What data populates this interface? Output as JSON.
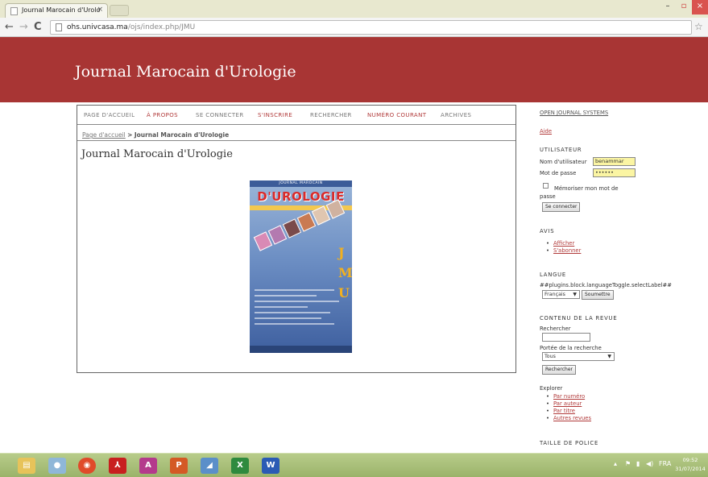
{
  "browser": {
    "tab_title": "Journal Marocain d'Urolo",
    "tab_close": "×",
    "url_host": "ohs.univcasa.ma",
    "url_path": "/ojs/index.php/JMU"
  },
  "header": {
    "journal_title": "Journal Marocain d'Urologie"
  },
  "nav": {
    "items": [
      "PAGE D'ACCUEIL",
      "À PROPOS",
      "SE CONNECTER",
      "S'INSCRIRE",
      "RECHERCHER",
      "NUMÉRO COURANT",
      "ARCHIVES"
    ]
  },
  "breadcrumb": {
    "home": "Page d'accueil",
    "separator": ">",
    "current": "Journal Marocain d'Urologie"
  },
  "main": {
    "title": "Journal Marocain d'Urologie"
  },
  "cover": {
    "small_title": "JOURNAL MAROCAIN",
    "big_title": "D'UROLOGIE",
    "letters": [
      "J",
      "M",
      "U"
    ]
  },
  "sidebar": {
    "ojs_link": "OPEN JOURNAL SYSTEMS",
    "help_link": "Aide",
    "user_heading": "UTILISATEUR",
    "username_label": "Nom d'utilisateur",
    "username_value": "benammar",
    "password_label": "Mot de passe",
    "password_value": "••••••",
    "remember_label_1": "Mémoriser mon mot de",
    "remember_label_2": "passe",
    "login_button": "Se connecter",
    "notices_heading": "AVIS",
    "notices_links": [
      "Afficher",
      "S'abonner"
    ],
    "language_heading": "LANGUE",
    "language_label": "##plugins.block.languageToggle.selectLabel##",
    "language_value": "Français",
    "language_submit": "Soumettre",
    "content_heading": "CONTENU DE LA REVUE",
    "search_label": "Rechercher",
    "scope_label": "Portée de la recherche",
    "scope_value": "Tous",
    "search_button": "Rechercher",
    "browse_label": "Explorer",
    "browse_links": [
      "Par numéro",
      "Par auteur",
      "Par titre",
      "Autres revues"
    ],
    "font_size_heading": "TAILLE DE POLICE"
  },
  "taskbar": {
    "tray_lang": "FRA",
    "clock_time": "09:52",
    "clock_date": "31/07/2014"
  },
  "colors": {
    "header_bg": "#a83534",
    "accent_red": "#b13a3a",
    "taskbar": "#9bb36a"
  }
}
